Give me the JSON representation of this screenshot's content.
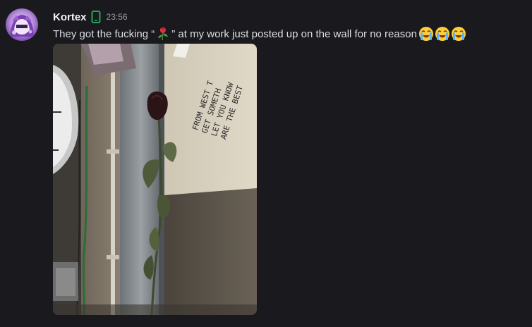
{
  "message": {
    "author": "Kortex",
    "timestamp": "23:56",
    "text_before_emoji": "They got the fucking “",
    "text_after_emoji": "” at my work just posted up on the wall for no reason",
    "inline_emoji_name": "wilted-rose-icon",
    "trailing_emojis": [
      "loudly-crying-face-icon",
      "loudly-crying-face-icon",
      "loudly-crying-face-icon"
    ],
    "author_icon": "mobile-phone-icon"
  },
  "attachment": {
    "note_lines": [
      "FROM WEST T",
      "GET SOMETH",
      "LET YOU KNOW",
      "ARE THE BEST"
    ]
  },
  "colors": {
    "background": "#1a1a1e",
    "username": "#f2f3f5",
    "timestamp": "#949ba4",
    "text": "#dbdee1",
    "mobile_icon": "#23a55a"
  }
}
